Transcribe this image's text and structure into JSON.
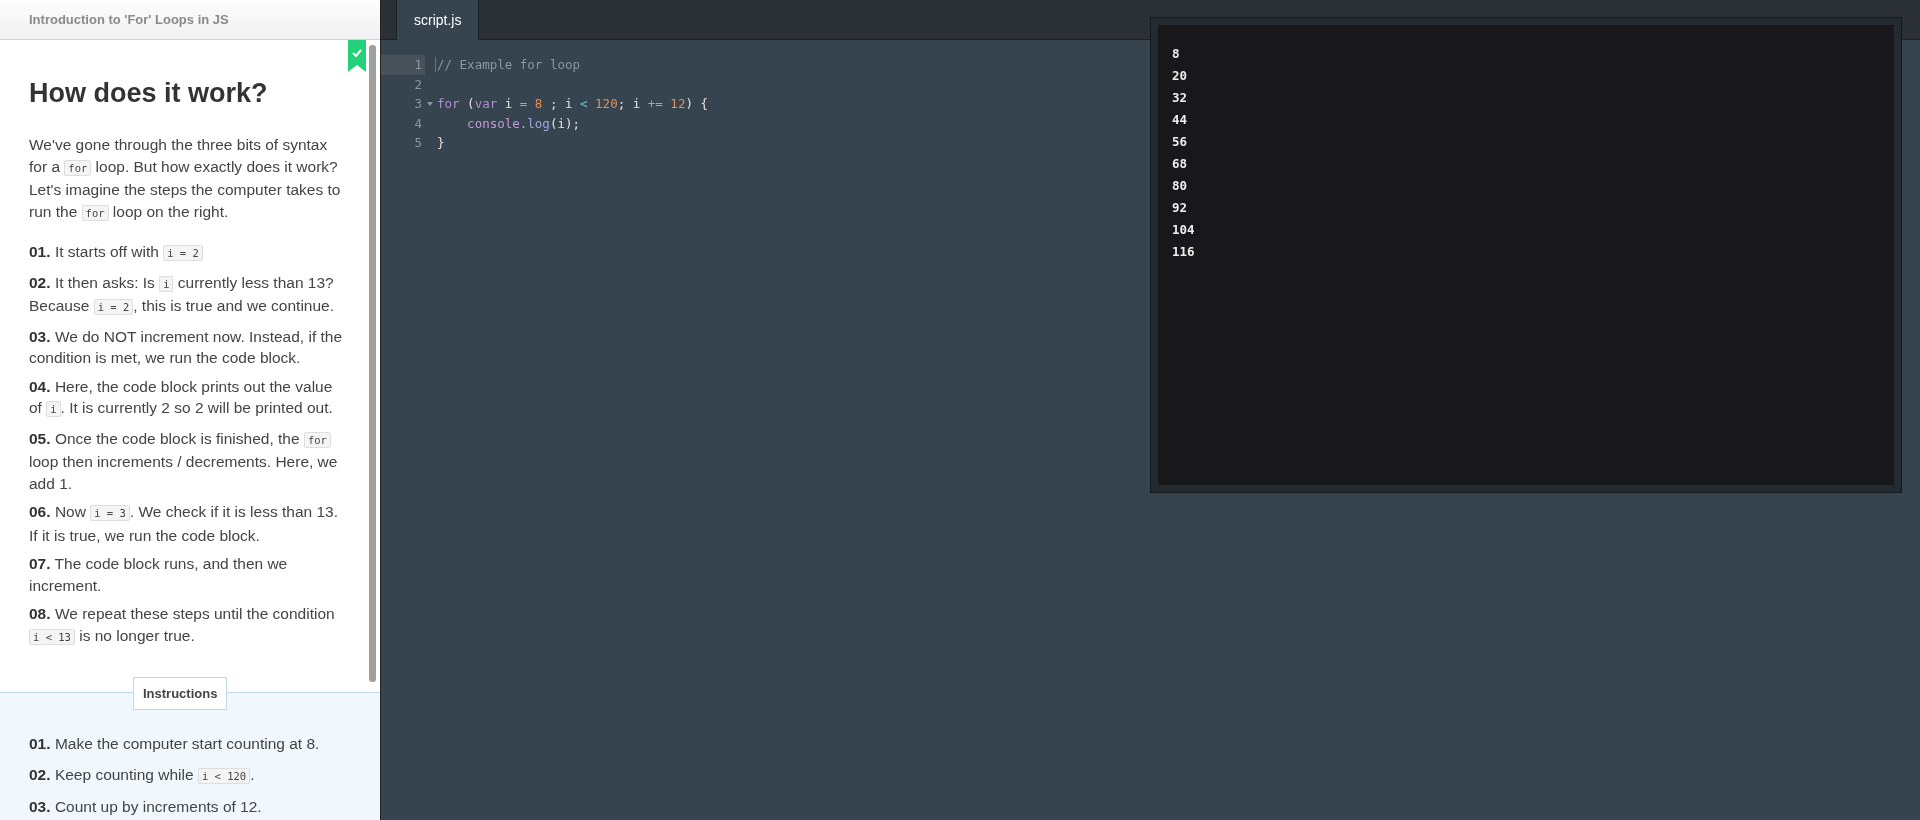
{
  "lesson": {
    "title": "Introduction to 'For' Loops in JS",
    "completed": true,
    "heading": "How does it work?",
    "intro": [
      {
        "kind": "text",
        "text": "We've gone through the three bits of syntax for a "
      },
      {
        "kind": "code",
        "text": "for"
      },
      {
        "kind": "text",
        "text": " loop. But how exactly does it work? Let's imagine the steps the computer takes to run the "
      },
      {
        "kind": "code",
        "text": "for"
      },
      {
        "kind": "text",
        "text": " loop on the right."
      }
    ],
    "steps": [
      {
        "number": "01.",
        "segments": [
          {
            "kind": "text",
            "text": "It starts off with "
          },
          {
            "kind": "code",
            "text": "i = 2"
          }
        ]
      },
      {
        "number": "02.",
        "segments": [
          {
            "kind": "text",
            "text": "It then asks: Is "
          },
          {
            "kind": "code",
            "text": "i"
          },
          {
            "kind": "text",
            "text": " currently less than 13? Because "
          },
          {
            "kind": "code",
            "text": "i = 2"
          },
          {
            "kind": "text",
            "text": ", this is true and we continue."
          }
        ]
      },
      {
        "number": "03.",
        "segments": [
          {
            "kind": "text",
            "text": "We do NOT increment now. Instead, if the condition is met, we run the code block."
          }
        ]
      },
      {
        "number": "04.",
        "segments": [
          {
            "kind": "text",
            "text": "Here, the code block prints out the value of "
          },
          {
            "kind": "code",
            "text": "i"
          },
          {
            "kind": "text",
            "text": ". It is currently 2 so 2 will be printed out."
          }
        ]
      },
      {
        "number": "05.",
        "segments": [
          {
            "kind": "text",
            "text": "Once the code block is finished, the "
          },
          {
            "kind": "code",
            "text": "for"
          },
          {
            "kind": "text",
            "text": " loop then increments / decrements. Here, we add 1."
          }
        ]
      },
      {
        "number": "06.",
        "segments": [
          {
            "kind": "text",
            "text": "Now "
          },
          {
            "kind": "code",
            "text": "i = 3"
          },
          {
            "kind": "text",
            "text": ". We check if it is less than 13. If it is true, we run the code block."
          }
        ]
      },
      {
        "number": "07.",
        "segments": [
          {
            "kind": "text",
            "text": "The code block runs, and then we increment."
          }
        ]
      },
      {
        "number": "08.",
        "segments": [
          {
            "kind": "text",
            "text": "We repeat these steps until the condition "
          },
          {
            "kind": "code",
            "text": "i < 13"
          },
          {
            "kind": "text",
            "text": " is no longer true."
          }
        ]
      }
    ]
  },
  "instructions": {
    "label": "Instructions",
    "steps": [
      {
        "number": "01.",
        "segments": [
          {
            "kind": "text",
            "text": "Make the computer start counting at 8."
          }
        ]
      },
      {
        "number": "02.",
        "segments": [
          {
            "kind": "text",
            "text": "Keep counting while "
          },
          {
            "kind": "code",
            "text": "i < 120"
          },
          {
            "kind": "text",
            "text": "."
          }
        ]
      },
      {
        "number": "03.",
        "segments": [
          {
            "kind": "text",
            "text": "Count up by increments of 12."
          }
        ]
      }
    ]
  },
  "editor": {
    "tabs": [
      {
        "label": "script.js",
        "selected": true
      }
    ],
    "lines": [
      {
        "number": "1",
        "active": true,
        "fold": false,
        "tokens": [
          {
            "kind": "comment",
            "text": "// Example for loop"
          }
        ]
      },
      {
        "number": "2",
        "active": false,
        "fold": false
      },
      {
        "number": "3",
        "active": false,
        "fold": true,
        "tokens": [
          {
            "kind": "keyword",
            "text": "for"
          },
          {
            "kind": "plain",
            "text": " ("
          },
          {
            "kind": "keyword",
            "text": "var"
          },
          {
            "kind": "plain",
            "text": " i "
          },
          {
            "kind": "operator",
            "text": "="
          },
          {
            "kind": "number",
            "text": " 8"
          },
          {
            "kind": "plain",
            "text": " ; i "
          },
          {
            "kind": "operator",
            "text": "<"
          },
          {
            "kind": "number",
            "text": " 120"
          },
          {
            "kind": "plain",
            "text": "; i "
          },
          {
            "kind": "operator",
            "text": "+="
          },
          {
            "kind": "number",
            "text": " 12"
          },
          {
            "kind": "plain",
            "text": ") {"
          }
        ]
      },
      {
        "number": "4",
        "active": false,
        "fold": false,
        "tokens": [
          {
            "kind": "builtin",
            "text": "    console."
          },
          {
            "kind": "method",
            "text": "log"
          },
          {
            "kind": "plain",
            "text": "(i);"
          }
        ]
      },
      {
        "number": "5",
        "active": false,
        "fold": false,
        "tokens": [
          {
            "kind": "plain",
            "text": "}"
          }
        ]
      }
    ]
  },
  "console": {
    "output": [
      "8",
      "20",
      "32",
      "44",
      "56",
      "68",
      "80",
      "92",
      "104",
      "116"
    ]
  }
}
